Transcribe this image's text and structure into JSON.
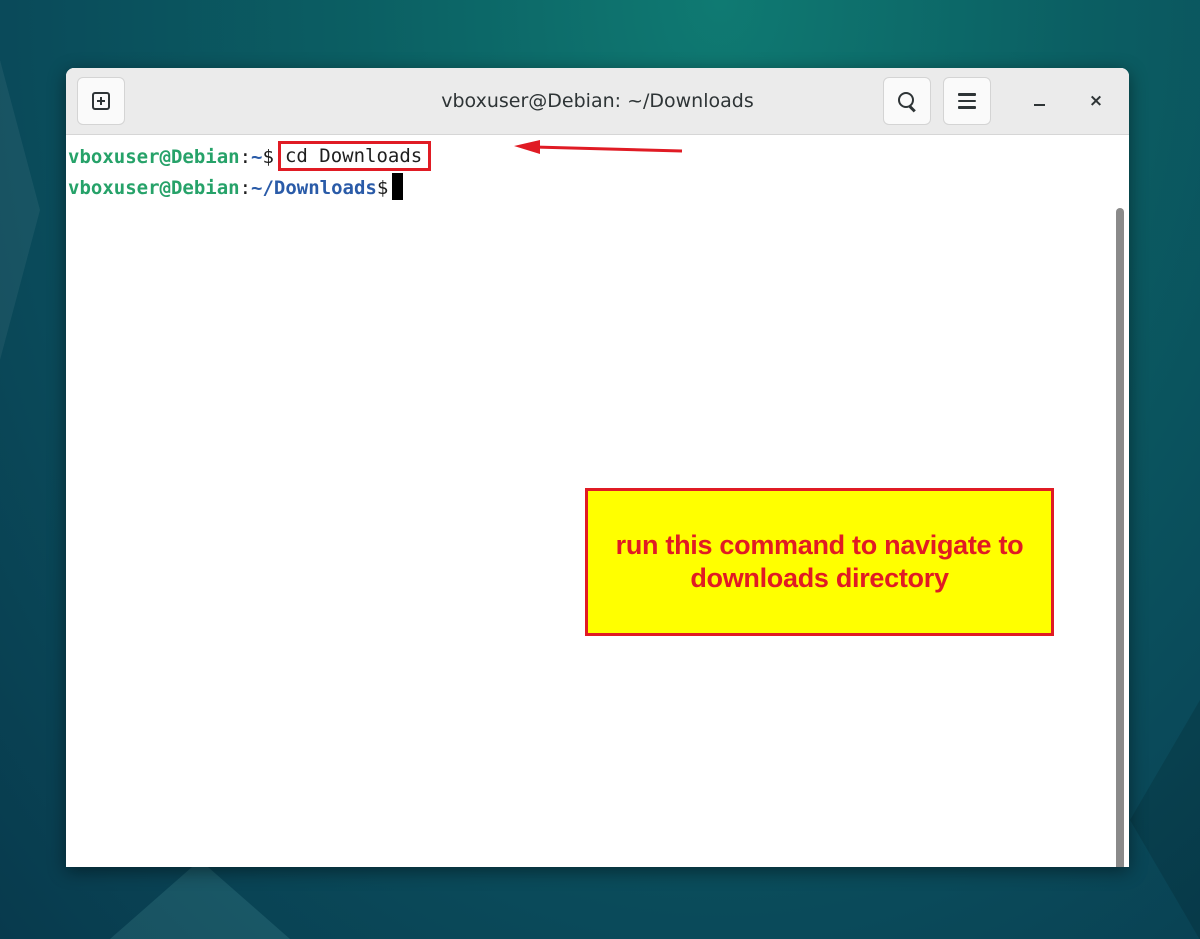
{
  "window": {
    "title": "vboxuser@Debian: ~/Downloads",
    "close_glyph": "×",
    "icons": {
      "new_tab": "new-tab-icon",
      "search": "search-icon",
      "menu": "hamburger-menu-icon",
      "minimize": "minimize-icon",
      "close": "close-icon"
    }
  },
  "terminal": {
    "line1": {
      "user_host": "vboxuser@Debian",
      "separator": ":",
      "path": "~",
      "symbol": "$",
      "command": "cd Downloads"
    },
    "line2": {
      "user_host": "vboxuser@Debian",
      "separator": ":",
      "path": "~/Downloads",
      "symbol": "$"
    }
  },
  "annotation": {
    "callout_text": "run this command to navigate to downloads directory",
    "colors": {
      "box_fill": "#ffff00",
      "highlight": "#e01b24"
    }
  },
  "colors": {
    "prompt_user": "#26a269",
    "prompt_path": "#2a5ba8",
    "headerbar": "#ebebeb",
    "terminal_bg": "#ffffff"
  }
}
